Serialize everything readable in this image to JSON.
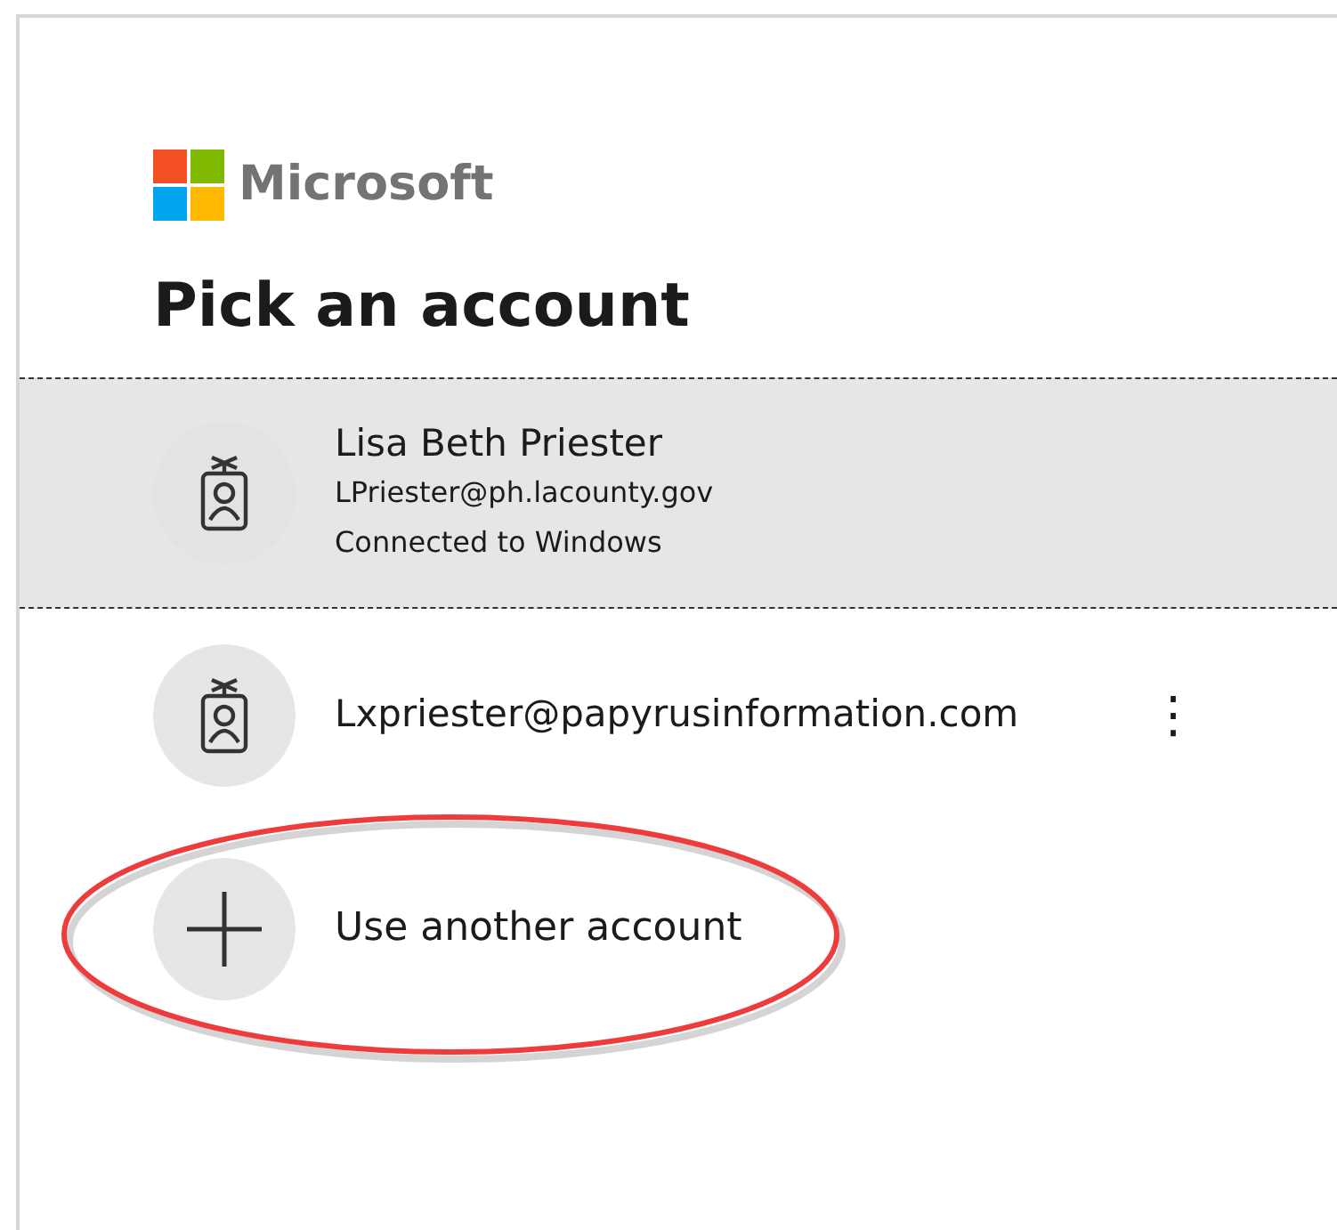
{
  "brand": {
    "name": "Microsoft"
  },
  "title": "Pick an account",
  "accounts": [
    {
      "kind": "account",
      "selected": true,
      "name": "Lisa Beth Priester",
      "email": "LPriester@ph.lacounty.gov",
      "status": "Connected to Windows"
    },
    {
      "kind": "account",
      "selected": false,
      "email": "Lxpriester@papyrusinformation.com",
      "menu_icon": "⋮"
    },
    {
      "kind": "add",
      "selected": false,
      "label": "Use another account",
      "highlighted": true
    }
  ]
}
